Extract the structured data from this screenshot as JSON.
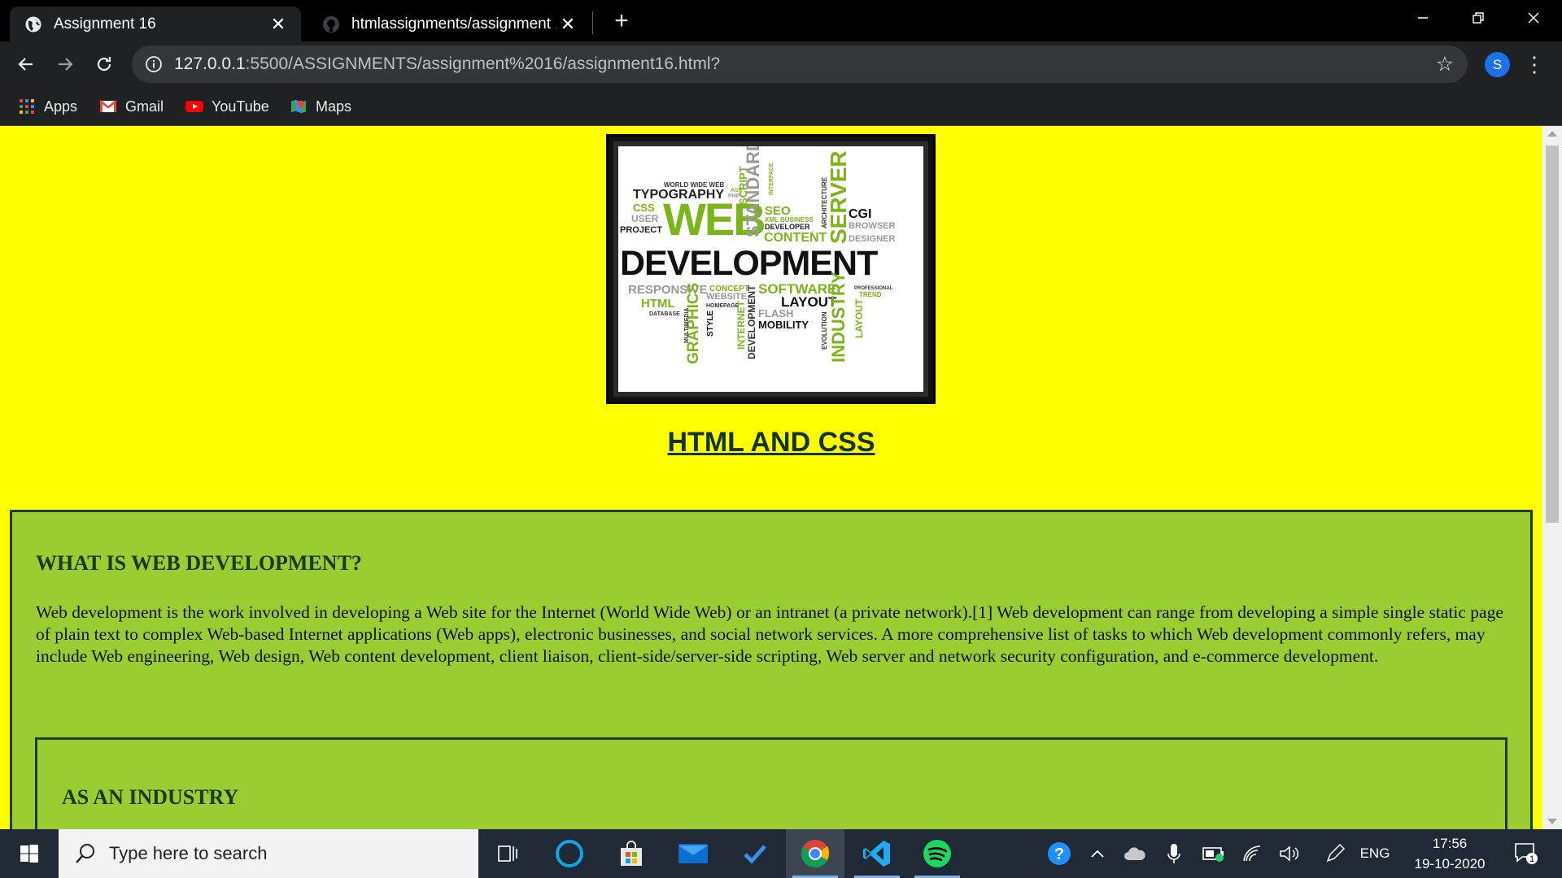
{
  "browser": {
    "tabs": [
      {
        "title": "Assignment 16",
        "active": true,
        "favicon": "globe-icon"
      },
      {
        "title": "htmlassignments/assignment 16",
        "active": false,
        "favicon": "github-icon"
      }
    ],
    "address": {
      "host": "127.0.0.1",
      "path": ":5500/ASSIGNMENTS/assignment%2016/assignment16.html?"
    },
    "profile_initial": "S",
    "bookmarks": [
      {
        "label": "Apps",
        "icon": "apps-grid-icon"
      },
      {
        "label": "Gmail",
        "icon": "gmail-icon"
      },
      {
        "label": "YouTube",
        "icon": "youtube-icon"
      },
      {
        "label": "Maps",
        "icon": "maps-icon"
      }
    ]
  },
  "page": {
    "background_color": "#ffff00",
    "hero_image_words": {
      "main1": "WEB",
      "main2": "DEVELOPMENT",
      "w1": "TYPOGRAPHY",
      "w2": "WORLD WIDE WEB",
      "w3": "CSS",
      "w4": "USER",
      "w5": "PROJECT",
      "w6": "SCRIPT",
      "w7": "STANDARD",
      "w8": "SEO",
      "w9": "DEVELOPER",
      "w10": "CONTENT",
      "w11": "SERVER",
      "w12": "CGI",
      "w13": "BROWSER",
      "w14": "DESIGNER",
      "w15": "RESPONSIVE",
      "w16": "CONCEPT",
      "w17": "SOFTWARE",
      "w18": "HTML",
      "w19": "WEBSITE",
      "w20": "LAYOUT",
      "w21": "FLASH",
      "w22": "MOBILITY",
      "w23": "DATABASE",
      "w24": "GRAPHICS",
      "w25": "STYLE",
      "w26": "INTERNET",
      "w27": "INDUSTRY",
      "w28": "TREND",
      "w29": "PROFESSIONAL",
      "w30": "ARCHITECTURE",
      "w31": "INTERFACE",
      "w32": "XML BUSINESS",
      "w33": "HOMEPAGE",
      "w34": "EVOLUTION",
      "w35": "MULTIMEDIA",
      "w36": "ASP",
      "w37": "PHP",
      "w38": "LAYOUT",
      "w39": "DEVELOPMENT"
    },
    "heading_link": "HTML AND CSS",
    "section": {
      "color": "#9acd32",
      "title": "WHAT IS WEB DEVELOPMENT?",
      "body": "Web development is the work involved in developing a Web site for the Internet (World Wide Web) or an intranet (a private network).[1] Web development can range from developing a simple single static page of plain text to complex Web-based Internet applications (Web apps), electronic businesses, and social network services. A more comprehensive list of tasks to which Web development commonly refers, may include Web engineering, Web design, Web content development, client liaison, client-side/server-side scripting, Web server and network security configuration, and e-commerce development.",
      "subsection_title": "AS AN INDUSTRY"
    }
  },
  "taskbar": {
    "search_placeholder": "Type here to search",
    "language": "ENG",
    "time": "17:56",
    "date": "19-10-2020",
    "notification_count": "1"
  }
}
